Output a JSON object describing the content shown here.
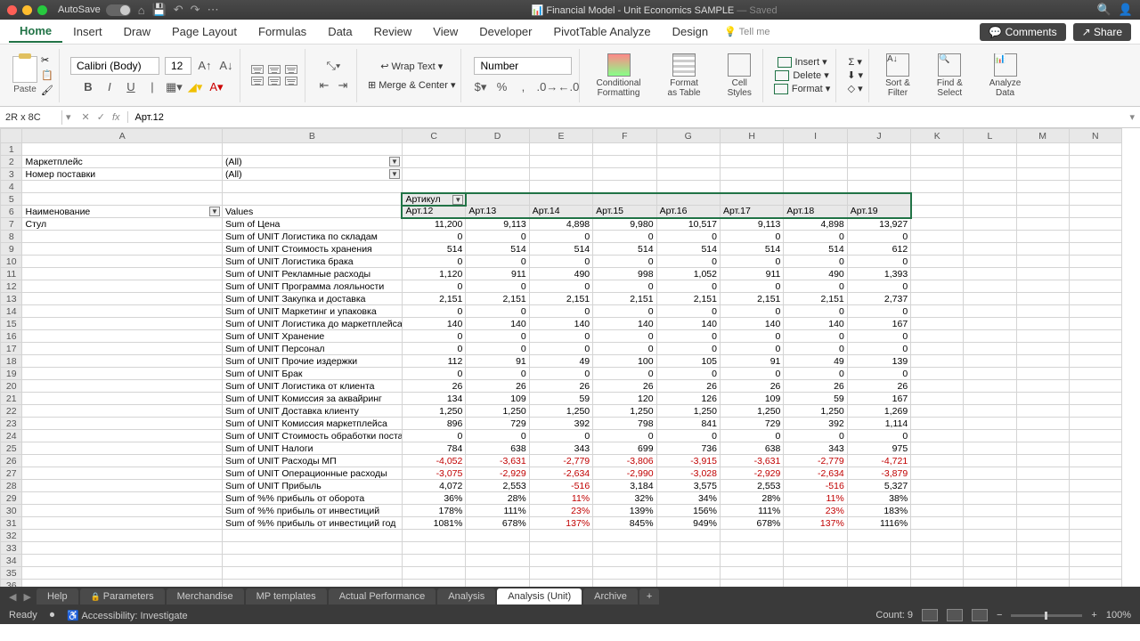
{
  "title": {
    "autosave": "AutoSave",
    "filename": "Financial Model - Unit Economics SAMPLE",
    "saved": "— Saved"
  },
  "menu": {
    "items": [
      "Home",
      "Insert",
      "Draw",
      "Page Layout",
      "Formulas",
      "Data",
      "Review",
      "View",
      "Developer",
      "PivotTable Analyze",
      "Design"
    ],
    "tellme": "Tell me",
    "comments": "Comments",
    "share": "Share"
  },
  "ribbon": {
    "paste": "Paste",
    "font": "Calibri (Body)",
    "size": "12",
    "wrap": "Wrap Text",
    "merge": "Merge & Center",
    "numfmt": "Number",
    "cond": "Conditional",
    "cond2": "Formatting",
    "fmttbl": "Format",
    "fmttbl2": "as Table",
    "cellst": "Cell",
    "cellst2": "Styles",
    "insert": "Insert",
    "delete": "Delete",
    "format": "Format",
    "sort": "Sort &",
    "sort2": "Filter",
    "find": "Find &",
    "find2": "Select",
    "analyze": "Analyze",
    "analyze2": "Data"
  },
  "fbar": {
    "ref": "2R x 8C",
    "fx": "Арт.12"
  },
  "cols": [
    "A",
    "B",
    "C",
    "D",
    "E",
    "F",
    "G",
    "H",
    "I",
    "J",
    "K",
    "L",
    "M",
    "N"
  ],
  "filters": {
    "f1": {
      "label": "Маркетплейс",
      "val": "(All)"
    },
    "f2": {
      "label": "Номер поставки",
      "val": "(All)"
    }
  },
  "pivot": {
    "artikul": "Артикул",
    "name": "Наименование",
    "values": "Values"
  },
  "arts": [
    "Арт.12",
    "Арт.13",
    "Арт.14",
    "Арт.15",
    "Арт.16",
    "Арт.17",
    "Арт.18",
    "Арт.19"
  ],
  "rowA": "Стул",
  "rows": [
    {
      "b": "Sum of Цена",
      "v": [
        "11,200",
        "9,113",
        "4,898",
        "9,980",
        "10,517",
        "9,113",
        "4,898",
        "13,927"
      ]
    },
    {
      "b": "Sum of UNIT Логистика по складам",
      "v": [
        "0",
        "0",
        "0",
        "0",
        "0",
        "0",
        "0",
        "0"
      ]
    },
    {
      "b": "Sum of UNIT Стоимость хранения",
      "v": [
        "514",
        "514",
        "514",
        "514",
        "514",
        "514",
        "514",
        "612"
      ]
    },
    {
      "b": "Sum of UNIT Логистика брака",
      "v": [
        "0",
        "0",
        "0",
        "0",
        "0",
        "0",
        "0",
        "0"
      ]
    },
    {
      "b": "Sum of UNIT Рекламные расходы",
      "v": [
        "1,120",
        "911",
        "490",
        "998",
        "1,052",
        "911",
        "490",
        "1,393"
      ]
    },
    {
      "b": "Sum of UNIT Программа лояльности",
      "v": [
        "0",
        "0",
        "0",
        "0",
        "0",
        "0",
        "0",
        "0"
      ]
    },
    {
      "b": "Sum of UNIT Закупка и доставка",
      "v": [
        "2,151",
        "2,151",
        "2,151",
        "2,151",
        "2,151",
        "2,151",
        "2,151",
        "2,737"
      ]
    },
    {
      "b": "Sum of UNIT Маркетинг и упаковка",
      "v": [
        "0",
        "0",
        "0",
        "0",
        "0",
        "0",
        "0",
        "0"
      ]
    },
    {
      "b": "Sum of UNIT Логистика до маркетплейса",
      "v": [
        "140",
        "140",
        "140",
        "140",
        "140",
        "140",
        "140",
        "167"
      ]
    },
    {
      "b": "Sum of UNIT Хранение",
      "v": [
        "0",
        "0",
        "0",
        "0",
        "0",
        "0",
        "0",
        "0"
      ]
    },
    {
      "b": "Sum of UNIT Персонал",
      "v": [
        "0",
        "0",
        "0",
        "0",
        "0",
        "0",
        "0",
        "0"
      ]
    },
    {
      "b": "Sum of UNIT Прочие издержки",
      "v": [
        "112",
        "91",
        "49",
        "100",
        "105",
        "91",
        "49",
        "139"
      ]
    },
    {
      "b": "Sum of UNIT Брак",
      "v": [
        "0",
        "0",
        "0",
        "0",
        "0",
        "0",
        "0",
        "0"
      ]
    },
    {
      "b": "Sum of UNIT Логистика от клиента",
      "v": [
        "26",
        "26",
        "26",
        "26",
        "26",
        "26",
        "26",
        "26"
      ]
    },
    {
      "b": "Sum of UNIT Комиссия за аквайринг",
      "v": [
        "134",
        "109",
        "59",
        "120",
        "126",
        "109",
        "59",
        "167"
      ]
    },
    {
      "b": "Sum of UNIT Доставка клиенту",
      "v": [
        "1,250",
        "1,250",
        "1,250",
        "1,250",
        "1,250",
        "1,250",
        "1,250",
        "1,269"
      ]
    },
    {
      "b": "Sum of UNIT Комиссия маркетплейса",
      "v": [
        "896",
        "729",
        "392",
        "798",
        "841",
        "729",
        "392",
        "1,114"
      ]
    },
    {
      "b": "Sum of UNIT Стоимость обработки поставк",
      "v": [
        "0",
        "0",
        "0",
        "0",
        "0",
        "0",
        "0",
        "0"
      ]
    },
    {
      "b": "Sum of UNIT Налоги",
      "v": [
        "784",
        "638",
        "343",
        "699",
        "736",
        "638",
        "343",
        "975"
      ]
    },
    {
      "b": "Sum of UNIT Расходы МП",
      "v": [
        "-4,052",
        "-3,631",
        "-2,779",
        "-3,806",
        "-3,915",
        "-3,631",
        "-2,779",
        "-4,721"
      ],
      "neg": true
    },
    {
      "b": "Sum of UNIT Операционные расходы",
      "v": [
        "-3,075",
        "-2,929",
        "-2,634",
        "-2,990",
        "-3,028",
        "-2,929",
        "-2,634",
        "-3,879"
      ],
      "neg": true
    },
    {
      "b": "Sum of UNIT Прибыль",
      "v": [
        "4,072",
        "2,553",
        "-516",
        "3,184",
        "3,575",
        "2,553",
        "-516",
        "5,327"
      ],
      "negIdx": [
        2,
        6
      ]
    },
    {
      "b": "Sum of %% прибыль от оборота",
      "v": [
        "36%",
        "28%",
        "11%",
        "32%",
        "34%",
        "28%",
        "11%",
        "38%"
      ],
      "negIdx": [
        2,
        6
      ]
    },
    {
      "b": "Sum of %% прибыль от инвестиций",
      "v": [
        "178%",
        "111%",
        "23%",
        "139%",
        "156%",
        "111%",
        "23%",
        "183%"
      ],
      "negIdx": [
        2,
        6
      ]
    },
    {
      "b": "Sum of %% прибыль от инвестиций год",
      "v": [
        "1081%",
        "678%",
        "137%",
        "845%",
        "949%",
        "678%",
        "137%",
        "1116%"
      ],
      "negIdx": [
        2,
        6
      ]
    }
  ],
  "tabs": {
    "help": "Help",
    "params": "Parameters",
    "merch": "Merchandise",
    "mpt": "MP templates",
    "actual": "Actual Performance",
    "analysis": "Analysis",
    "aunit": "Analysis (Unit)",
    "archive": "Archive"
  },
  "status": {
    "ready": "Ready",
    "acc": "Accessibility: Investigate",
    "count": "Count: 9",
    "zoom": "100%"
  }
}
